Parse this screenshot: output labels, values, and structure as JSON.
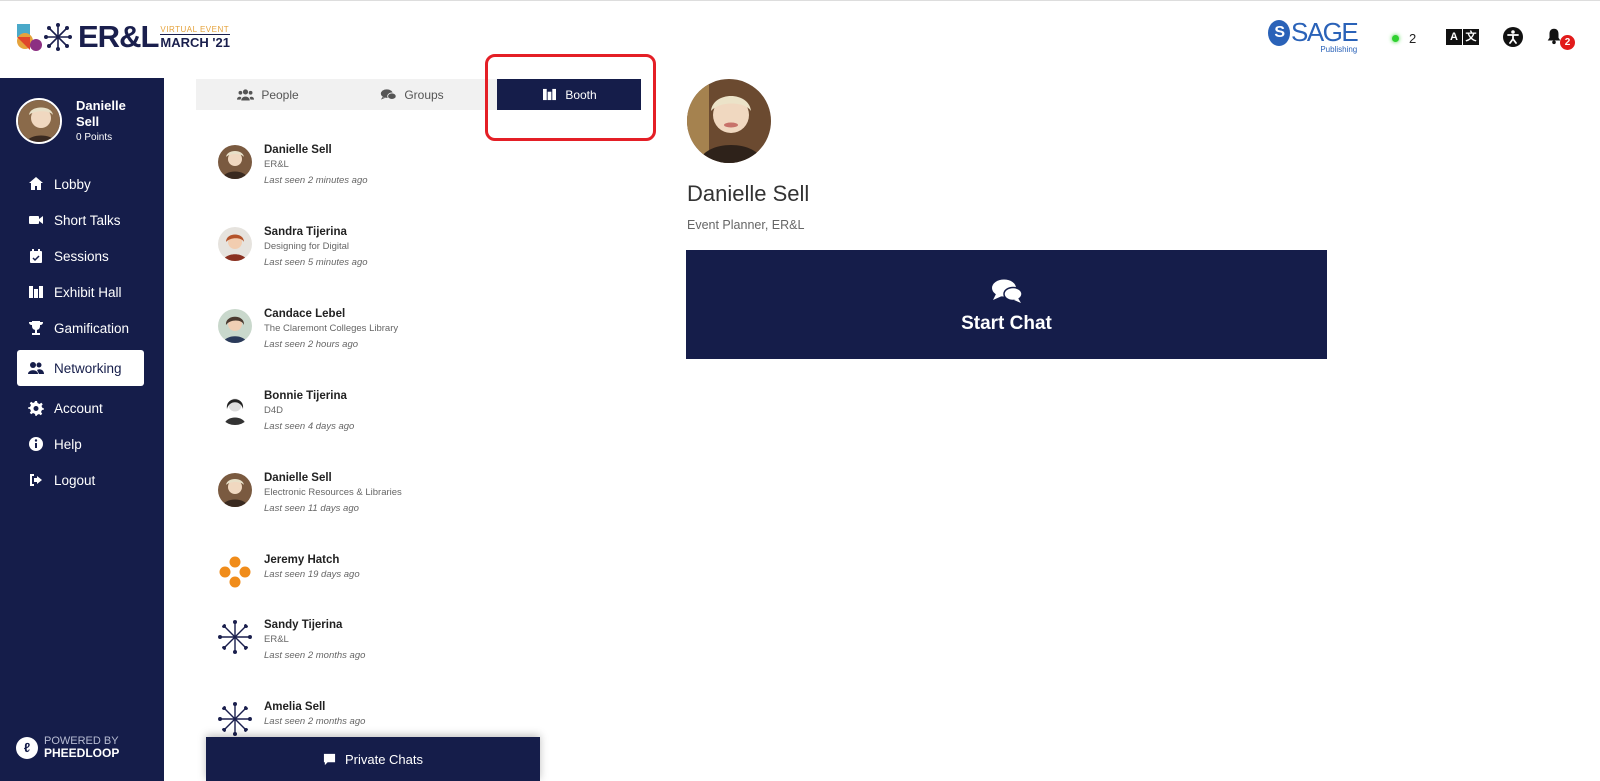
{
  "header": {
    "logo": {
      "name": "ER&L",
      "virtual_label": "VIRTUAL EVENT",
      "month_label": "MARCH '21"
    },
    "sponsor": {
      "name": "SAGE",
      "sub": "Publishing"
    },
    "online_count": "2",
    "notification_count": "2",
    "icons": [
      "translate-icon",
      "accessibility-icon",
      "bell-icon"
    ]
  },
  "sidebar": {
    "profile": {
      "first_name": "Danielle",
      "last_name": "Sell",
      "points": "0 Points"
    },
    "items": [
      {
        "label": "Lobby",
        "icon": "home-icon"
      },
      {
        "label": "Short Talks",
        "icon": "video-icon"
      },
      {
        "label": "Sessions",
        "icon": "calendar-icon"
      },
      {
        "label": "Exhibit Hall",
        "icon": "booth-icon"
      },
      {
        "label": "Gamification",
        "icon": "trophy-icon"
      },
      {
        "label": "Networking",
        "icon": "users-icon",
        "active": true
      },
      {
        "label": "Account",
        "icon": "gear-icon"
      },
      {
        "label": "Help",
        "icon": "info-icon"
      },
      {
        "label": "Logout",
        "icon": "logout-icon"
      }
    ],
    "powered_by": {
      "label": "POWERED BY",
      "brand": "PHEEDLOOP"
    }
  },
  "tabs": [
    {
      "label": "People",
      "icon": "users-icon"
    },
    {
      "label": "Groups",
      "icon": "comments-icon"
    },
    {
      "label": "Booth",
      "icon": "booth-icon",
      "active": true
    }
  ],
  "members": [
    {
      "name": "Danielle Sell",
      "org": "ER&L",
      "seen": "Last seen 2 minutes ago",
      "avatar": "photo"
    },
    {
      "name": "Sandra Tijerina",
      "org": "Designing for Digital",
      "seen": "Last seen 5 minutes ago",
      "avatar": "photo"
    },
    {
      "name": "Candace Lebel",
      "org": "The Claremont Colleges Library",
      "seen": "Last seen 2 hours ago",
      "avatar": "photo"
    },
    {
      "name": "Bonnie Tijerina",
      "org": "D4D",
      "seen": "Last seen 4 days ago",
      "avatar": "photo"
    },
    {
      "name": "Danielle Sell",
      "org": "Electronic Resources & Libraries",
      "seen": "Last seen 11 days ago",
      "avatar": "photo"
    },
    {
      "name": "Jeremy Hatch",
      "org": "",
      "seen": "Last seen 19 days ago",
      "avatar": "orange-dots"
    },
    {
      "name": "Sandy Tijerina",
      "org": "ER&L",
      "seen": "Last seen 2 months ago",
      "avatar": "snowflake"
    },
    {
      "name": "Amelia Sell",
      "org": "",
      "seen": "Last seen 2 months ago",
      "avatar": "snowflake"
    }
  ],
  "private_chats_label": "Private Chats",
  "detail": {
    "name": "Danielle Sell",
    "title": "Event Planner, ER&L",
    "start_chat_label": "Start Chat"
  },
  "colors": {
    "navy": "#151d4a",
    "highlight": "#e41f26",
    "online": "#2fd12f",
    "badge": "#e21b1b",
    "sponsor": "#2a62b8"
  }
}
